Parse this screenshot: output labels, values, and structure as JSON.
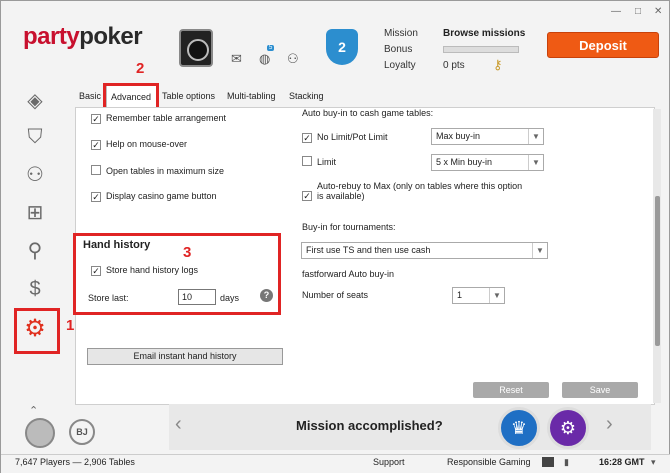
{
  "window": {
    "minimize": "—",
    "maximize": "□",
    "close": "✕"
  },
  "brand": {
    "logo_left": "party",
    "logo_right": "poker",
    "accent": "#c8102e"
  },
  "header": {
    "level_badge": "2",
    "mission_label": "Mission",
    "bonus_label": "Bonus",
    "loyalty_label": "Loyalty",
    "browse_missions": "Browse missions",
    "loyalty_points": "0 pts",
    "deposit_label": "Deposit",
    "notification_count": "5",
    "mail_icon": "mail-icon",
    "globe_icon": "globe-icon",
    "friends_icon": "friends-icon"
  },
  "sidebar": {
    "items": [
      {
        "icon": "lobby-icon",
        "glyph": "◈"
      },
      {
        "icon": "shield-icon",
        "glyph": "⛉"
      },
      {
        "icon": "groups-icon",
        "glyph": "⚇"
      },
      {
        "icon": "gift-icon",
        "glyph": "⊞"
      },
      {
        "icon": "account-icon",
        "glyph": "⚲"
      },
      {
        "icon": "cashier-icon",
        "glyph": "$"
      },
      {
        "icon": "settings-icon",
        "glyph": "⚙",
        "active": true
      }
    ],
    "scroll_up": "⌃"
  },
  "tabs": [
    "Basic",
    "Advanced",
    "Table options",
    "Multi-tabling",
    "Stacking"
  ],
  "active_tab": "Advanced",
  "settings": {
    "remember_table": "Remember table arrangement",
    "help_mouse": "Help on mouse-over",
    "open_max": "Open tables in maximum size",
    "casino_btn": "Display casino game button",
    "hand_history_title": "Hand history",
    "store_hh": "Store hand history logs",
    "store_last_label": "Store last:",
    "store_last_value": "10",
    "days_label": "days",
    "help_glyph": "?",
    "email_btn": "Email instant hand history",
    "auto_buyin_title": "Auto buy-in to cash game tables:",
    "nl_pl": "No Limit/Pot Limit",
    "nl_pl_select": "Max buy-in",
    "limit": "Limit",
    "limit_select": "5 x Min buy-in",
    "auto_rebuy": "Auto-rebuy to Max (only on tables where this option",
    "auto_rebuy_2": "is available)",
    "buyin_tournaments": "Buy-in for tournaments:",
    "tourn_select": "First use TS and then use cash",
    "fastforward": "fastforward Auto buy-in",
    "seats_label": "Number of seats",
    "seats_value": "1",
    "reset_btn": "Reset",
    "save_btn": "Save"
  },
  "annotations": {
    "one": "1",
    "two": "2",
    "three": "3",
    "color": "#e02424"
  },
  "banner": {
    "title": "Mission accomplished?",
    "left_arrow": "‹",
    "right_arrow": "›"
  },
  "status": {
    "players": "7,647 Players — 2,906 Tables",
    "support": "Support",
    "responsible": "Responsible Gaming",
    "time": "16:28 GMT"
  }
}
